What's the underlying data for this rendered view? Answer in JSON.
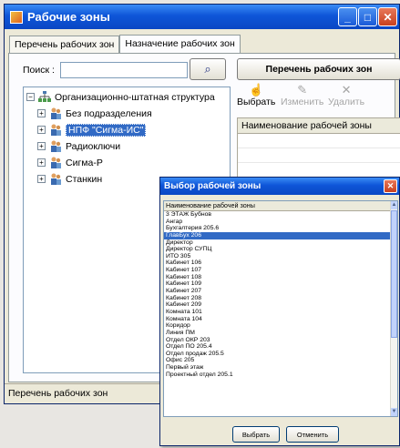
{
  "main": {
    "title": "Рабочие зоны",
    "tabs": [
      "Перечень рабочих зон",
      "Назначение рабочих зон"
    ],
    "search_label": "Поиск :",
    "search_value": "",
    "tree": {
      "root": "Организационно-штатная структура",
      "items": [
        "Без подразделения",
        "НПФ \"Сигма-ИС\"",
        "Радиоключи",
        "Сигма-Р",
        "Станкин"
      ],
      "selected": "НПФ \"Сигма-ИС\""
    },
    "right_header": "Перечень рабочих зон",
    "toolbar": {
      "select": "Выбрать",
      "edit": "Изменить",
      "delete": "Удалить"
    },
    "grid_column": "Наименование рабочей зоны",
    "status": "Перечень рабочих зон"
  },
  "dialog": {
    "title": "Выбор рабочей зоны",
    "column": "Наименование рабочей зоны",
    "rows": [
      "3 ЭТАЖ Бубнов",
      "Ангар",
      "Бухгалтерия 205.6",
      "ГлавБух 206",
      "Директор",
      "Директор СУПЦ",
      "ИТО 305",
      "Кабинет 106",
      "Кабинет 107",
      "Кабинет 108",
      "Кабинет 109",
      "Кабинет 207",
      "Кабинет 208",
      "Кабинет 209",
      "Комната 101",
      "Комната 104",
      "Коридор",
      "Линия ПМ",
      "Отдел ОКР 203",
      "Отдел ПО 205.4",
      "Отдел продаж 205.5",
      "Офис 205",
      "Первый этаж",
      "Проектный отдел 205.1"
    ],
    "selected_row": "ГлавБух 206",
    "select_btn": "Выбрать",
    "cancel_btn": "Отменить"
  }
}
